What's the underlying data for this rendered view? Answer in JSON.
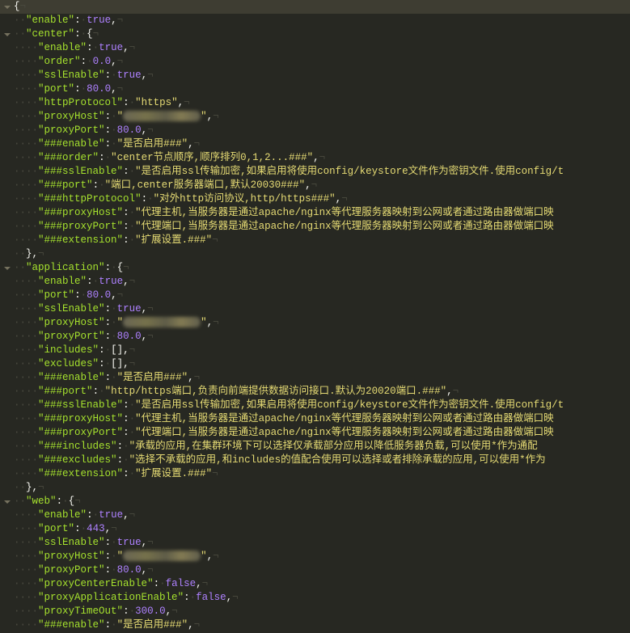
{
  "colors": {
    "background": "#272822",
    "key": "#a6e22e",
    "string": "#e6db74",
    "number": "#ae81ff",
    "punct": "#f8f8f2",
    "whitespace": "#4a4a3f"
  },
  "lines": [
    {
      "indent": 0,
      "raw": "{",
      "fold": true,
      "active": true
    },
    {
      "indent": 2,
      "key": "enable",
      "val": "true",
      "type": "n",
      "comma": true
    },
    {
      "indent": 2,
      "key": "center",
      "open": "{",
      "fold": true
    },
    {
      "indent": 4,
      "key": "enable",
      "val": "true",
      "type": "n",
      "comma": true
    },
    {
      "indent": 4,
      "key": "order",
      "val": "0.0",
      "type": "n",
      "comma": true
    },
    {
      "indent": 4,
      "key": "sslEnable",
      "val": "true",
      "type": "n",
      "comma": true
    },
    {
      "indent": 4,
      "key": "port",
      "val": "80.0",
      "type": "n",
      "comma": true
    },
    {
      "indent": 4,
      "key": "httpProtocol",
      "val": "https",
      "type": "s",
      "comma": true
    },
    {
      "indent": 4,
      "key": "proxyHost",
      "val": "",
      "type": "blur",
      "comma": true
    },
    {
      "indent": 4,
      "key": "proxyPort",
      "val": "80.0",
      "type": "n",
      "comma": true
    },
    {
      "indent": 4,
      "key": "###enable",
      "val": "是否启用###",
      "type": "s",
      "comma": true
    },
    {
      "indent": 4,
      "key": "###order",
      "val": "center节点顺序,顺序排列0,1,2...###",
      "type": "s",
      "comma": true
    },
    {
      "indent": 4,
      "key": "###sslEnable",
      "val": "是否启用ssl传输加密,如果启用将使用config/keystore文件作为密钥文件.使用config/t",
      "type": "s",
      "cut": true
    },
    {
      "indent": 4,
      "key": "###port",
      "val": "端口,center服务器端口,默认20030###",
      "type": "s",
      "comma": true
    },
    {
      "indent": 4,
      "key": "###httpProtocol",
      "val": "对外http访问协议,http/https###",
      "type": "s",
      "comma": true
    },
    {
      "indent": 4,
      "key": "###proxyHost",
      "val": "代理主机,当服务器是通过apache/nginx等代理服务器映射到公网或者通过路由器做端口映",
      "type": "s",
      "cut": true
    },
    {
      "indent": 4,
      "key": "###proxyPort",
      "val": "代理端口,当服务器是通过apache/nginx等代理服务器映射到公网或者通过路由器做端口映",
      "type": "s",
      "cut": true
    },
    {
      "indent": 4,
      "key": "###extension",
      "val": "扩展设置.###",
      "type": "s"
    },
    {
      "indent": 2,
      "raw": "},"
    },
    {
      "indent": 2,
      "key": "application",
      "open": "{",
      "fold": true
    },
    {
      "indent": 4,
      "key": "enable",
      "val": "true",
      "type": "n",
      "comma": true
    },
    {
      "indent": 4,
      "key": "port",
      "val": "80.0",
      "type": "n",
      "comma": true
    },
    {
      "indent": 4,
      "key": "sslEnable",
      "val": "true",
      "type": "n",
      "comma": true
    },
    {
      "indent": 4,
      "key": "proxyHost",
      "val": "",
      "type": "blur",
      "comma": true
    },
    {
      "indent": 4,
      "key": "proxyPort",
      "val": "80.0",
      "type": "n",
      "comma": true
    },
    {
      "indent": 4,
      "key": "includes",
      "val": "[]",
      "type": "p",
      "comma": true
    },
    {
      "indent": 4,
      "key": "excludes",
      "val": "[]",
      "type": "p",
      "comma": true
    },
    {
      "indent": 4,
      "key": "###enable",
      "val": "是否启用###",
      "type": "s",
      "comma": true
    },
    {
      "indent": 4,
      "key": "###port",
      "val": "http/https端口,负责向前端提供数据访问接口.默认为20020端口.###",
      "type": "s",
      "comma": true
    },
    {
      "indent": 4,
      "key": "###sslEnable",
      "val": "是否启用ssl传输加密,如果启用将使用config/keystore文件作为密钥文件.使用config/t",
      "type": "s",
      "cut": true
    },
    {
      "indent": 4,
      "key": "###proxyHost",
      "val": "代理主机,当服务器是通过apache/nginx等代理服务器映射到公网或者通过路由器做端口映",
      "type": "s",
      "cut": true
    },
    {
      "indent": 4,
      "key": "###proxyPort",
      "val": "代理端口,当服务器是通过apache/nginx等代理服务器映射到公网或者通过路由器做端口映",
      "type": "s",
      "cut": true
    },
    {
      "indent": 4,
      "key": "###includes",
      "val": "承载的应用,在集群环境下可以选择仅承载部分应用以降低服务器负载,可以使用*作为通配",
      "type": "s",
      "cut": true
    },
    {
      "indent": 4,
      "key": "###excludes",
      "val": "选择不承载的应用,和includes的值配合使用可以选择或者排除承载的应用,可以使用*作为",
      "type": "s",
      "cut": true
    },
    {
      "indent": 4,
      "key": "###extension",
      "val": "扩展设置.###",
      "type": "s"
    },
    {
      "indent": 2,
      "raw": "},"
    },
    {
      "indent": 2,
      "key": "web",
      "open": "{",
      "fold": true
    },
    {
      "indent": 4,
      "key": "enable",
      "val": "true",
      "type": "n",
      "comma": true
    },
    {
      "indent": 4,
      "key": "port",
      "val": "443",
      "type": "n",
      "comma": true
    },
    {
      "indent": 4,
      "key": "sslEnable",
      "val": "true",
      "type": "n",
      "comma": true
    },
    {
      "indent": 4,
      "key": "proxyHost",
      "val": "",
      "type": "blur",
      "comma": true
    },
    {
      "indent": 4,
      "key": "proxyPort",
      "val": "80.0",
      "type": "n",
      "comma": true
    },
    {
      "indent": 4,
      "key": "proxyCenterEnable",
      "val": "false",
      "type": "n",
      "comma": true
    },
    {
      "indent": 4,
      "key": "proxyApplicationEnable",
      "val": "false",
      "type": "n",
      "comma": true
    },
    {
      "indent": 4,
      "key": "proxyTimeOut",
      "val": "300.0",
      "type": "n",
      "comma": true
    },
    {
      "indent": 4,
      "key": "###enable",
      "val": "是否启用###",
      "type": "s",
      "comma": true
    }
  ]
}
